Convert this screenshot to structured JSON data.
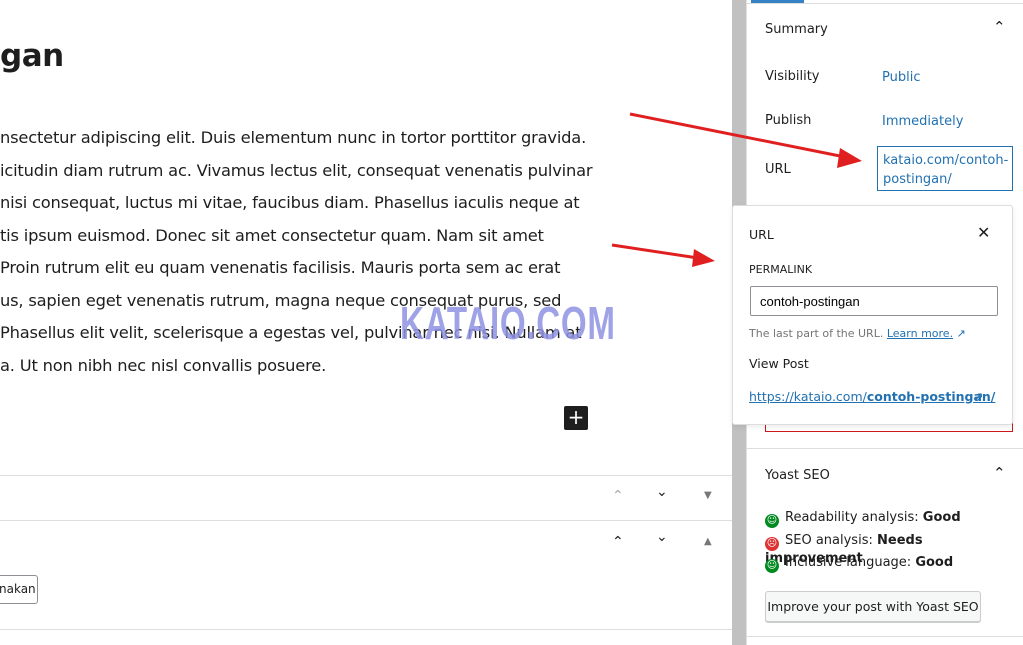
{
  "editor": {
    "title": "gan",
    "paragraph": [
      "nsectetur adipiscing elit. Duis elementum nunc in tortor porttitor gravida.",
      "icitudin diam rutrum ac. Vivamus lectus elit, consequat venenatis pulvinar",
      " nisi consequat, luctus mi vitae, faucibus diam. Phasellus iaculis neque at",
      "tis ipsum euismod. Donec sit amet consectetur quam. Nam sit amet",
      "Proin rutrum elit eu quam venenatis facilisis. Mauris porta sem ac erat",
      "us, sapien eget venenatis rutrum, magna neque consequat purus, sed",
      "Phasellus elit velit, scelerisque a egestas vel, pulvinar nec nisi. Nullam at",
      "a. Ut non nibh nec nisl convallis posuere."
    ],
    "add_block": "+",
    "select_value": "nakan"
  },
  "summary": {
    "heading": "Summary",
    "visibility_label": "Visibility",
    "visibility_value": "Public",
    "publish_label": "Publish",
    "publish_value": "Immediately",
    "url_label": "URL",
    "url_value": "kataio.com/contoh-postingan/"
  },
  "url_popover": {
    "title": "URL",
    "permalink_label": "PERMALINK",
    "permalink_value": "contoh-postingan",
    "help_text": "The last part of the URL.",
    "learn_more": "Learn more.",
    "view_post": "View Post",
    "link_prefix": "https://kataio.com/",
    "link_slug": "contoh-postingan/"
  },
  "yoast": {
    "heading": "Yoast SEO",
    "items": [
      {
        "label": "Readability analysis:",
        "value": "Good",
        "status": "good"
      },
      {
        "label": "SEO analysis:",
        "value": "Needs improvement",
        "status": "bad"
      },
      {
        "label": "Inclusive language:",
        "value": "Good",
        "status": "good"
      }
    ],
    "button": "Improve your post with Yoast SEO"
  },
  "watermark": "KATAIO.COM",
  "colors": {
    "link": "#2271b1",
    "good": "#008a20",
    "bad": "#dc3232",
    "arrow": "#e02020"
  }
}
